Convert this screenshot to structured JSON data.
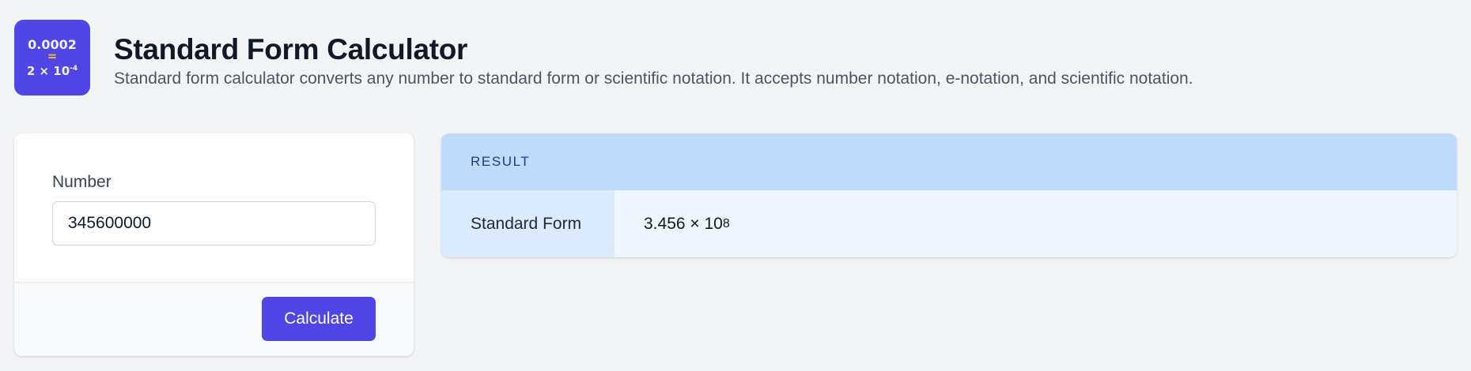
{
  "header": {
    "logo": {
      "line1": "0.0002",
      "line2": "=",
      "line3_base": "2 × 10",
      "line3_exp": "-4"
    },
    "title": "Standard Form Calculator",
    "subtitle": "Standard form calculator converts any number to standard form or scientific notation. It accepts number notation, e-notation, and scientific notation."
  },
  "form": {
    "number_label": "Number",
    "number_value": "345600000",
    "calculate_label": "Calculate"
  },
  "result": {
    "heading": "RESULT",
    "row_label": "Standard Form",
    "value_base": "3.456 × 10",
    "value_exponent": "8"
  },
  "colors": {
    "accent": "#4f46e5",
    "result_header": "#bfdbfe",
    "result_label_bg": "#dbeafe",
    "result_value_bg": "#eff6ff"
  }
}
